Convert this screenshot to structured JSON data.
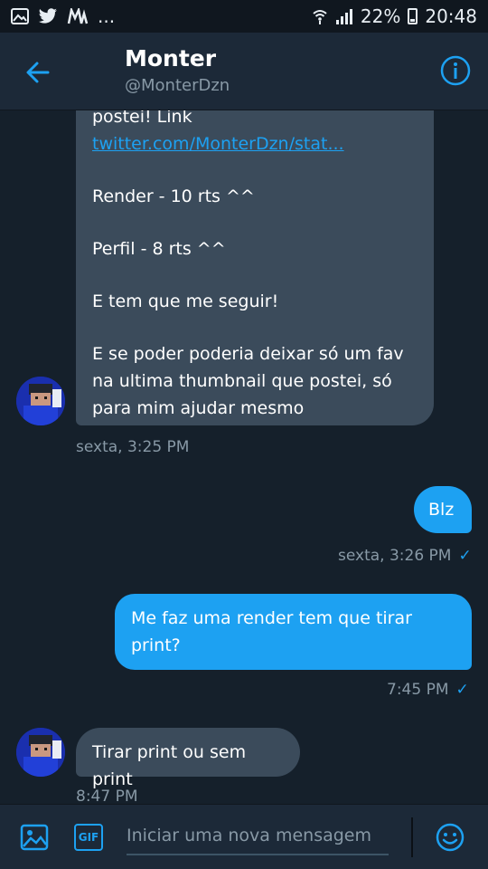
{
  "status_bar": {
    "left_icons": [
      "image-icon",
      "twitter-bird-icon",
      "m-app-icon",
      "more-dots"
    ],
    "more": "...",
    "battery": "22%",
    "time": "20:48"
  },
  "header": {
    "name": "Monter",
    "handle": "@MonterDzn"
  },
  "messages": [
    {
      "direction": "incoming",
      "lines": [
        {
          "text": "postei! Link ",
          "link": "twitter.com/MonterDzn/stat..."
        },
        {
          "text": "Render - 10 rts ^^"
        },
        {
          "text": "Perfil - 8 rts ^^"
        },
        {
          "text": "E tem que me seguir!"
        },
        {
          "text": "E se poder poderia deixar só um fav na ultima thumbnail que postei, só para mim ajudar mesmo"
        }
      ],
      "timestamp": "sexta, 3:25 PM"
    },
    {
      "direction": "outgoing",
      "text": "Blz",
      "timestamp": "sexta, 3:26 PM"
    },
    {
      "direction": "outgoing",
      "text": "Me faz uma render tem que tirar print?",
      "timestamp": "7:45 PM"
    },
    {
      "direction": "incoming",
      "text": "Tirar print ou sem print",
      "timestamp": "8:47 PM"
    }
  ],
  "composer": {
    "gif_label": "GIF",
    "placeholder": "Iniciar uma nova mensagem"
  },
  "colors": {
    "background": "#15202b",
    "header": "#1c2938",
    "incoming_bubble": "#3b4b5b",
    "outgoing_bubble": "#1da1f2",
    "accent": "#1da1f2",
    "muted": "#8899a6"
  }
}
